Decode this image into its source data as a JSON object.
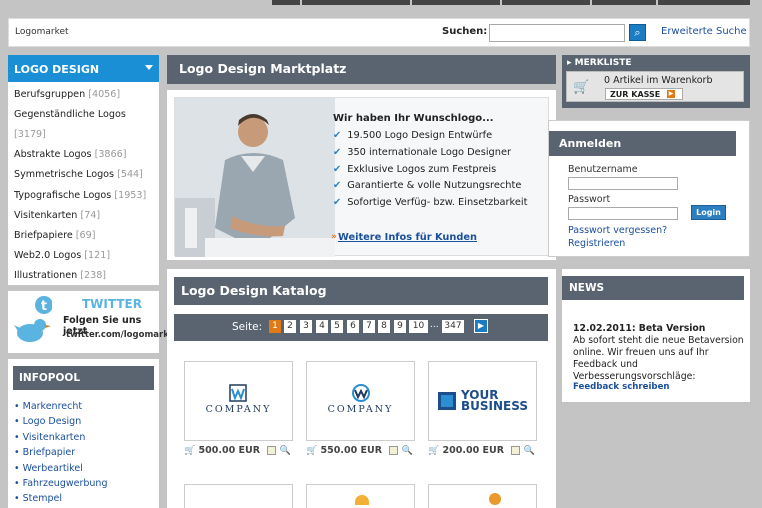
{
  "header": {
    "breadcrumb": "Logomarket",
    "search_label": "Suchen:",
    "search_placeholder": "",
    "advanced_search": "Erweiterte Suche"
  },
  "categories": {
    "title": "LOGO DESIGN",
    "items": [
      {
        "label": "Berufsgruppen",
        "count": "[4056]"
      },
      {
        "label": "Gegenständliche Logos",
        "count": "[3179]"
      },
      {
        "label": "Abstrakte Logos",
        "count": "[3866]"
      },
      {
        "label": "Symmetrische Logos",
        "count": "[544]"
      },
      {
        "label": "Typografische Logos",
        "count": "[1953]"
      },
      {
        "label": "Visitenkarten",
        "count": "[74]"
      },
      {
        "label": "Briefpapiere",
        "count": "[69]"
      },
      {
        "label": "Web2.0 Logos",
        "count": "[121]"
      },
      {
        "label": "Illustrationen",
        "count": "[238]"
      }
    ]
  },
  "twitter": {
    "title": "TWITTER",
    "follow": "Folgen Sie uns jetzt",
    "url": "twitter.com/logomarket"
  },
  "infopool": {
    "title": "INFOPOOL",
    "items": [
      "Markenrecht",
      "Logo Design",
      "Visitenkarten",
      "Briefpapier",
      "Werbeartikel",
      "Fahrzeugwerbung",
      "Stempel"
    ]
  },
  "main": {
    "title": "Logo Design Marktplatz"
  },
  "merkliste": {
    "title": "MERKLISTE",
    "count_text": "0 Artikel im Warenkorb",
    "checkout": "ZUR KASSE"
  },
  "hero": {
    "title": "Wir haben Ihr Wunschlogo...",
    "bullets": [
      "19.500 Logo Design Entwürfe",
      "350 internationale Logo Designer",
      "Exklusive Logos zum Festpreis",
      "Garantierte & volle Nutzungsrechte",
      "Sofortige Verfüg- bzw. Einsetzbarkeit"
    ],
    "more_link": "Weitere Infos für Kunden"
  },
  "login": {
    "title": "Anmelden",
    "username_label": "Benutzername",
    "password_label": "Passwort",
    "button": "Login",
    "forgot": "Passwort vergessen?",
    "register": "Registrieren"
  },
  "katalog": {
    "title": "Logo Design Katalog",
    "page_label": "Seite:",
    "pages": [
      "1",
      "2",
      "3",
      "4",
      "5",
      "6",
      "7",
      "8",
      "9",
      "10"
    ],
    "ellipsis": "...",
    "last_page": "347",
    "products": [
      {
        "price": "500.00 EUR",
        "logo_text": "COMPANY"
      },
      {
        "price": "550.00 EUR",
        "logo_text": "COMPANY"
      },
      {
        "price": "200.00 EUR",
        "logo_text": "YOUR BUSINESS"
      }
    ]
  },
  "news": {
    "title": "NEWS",
    "headline": "12.02.2011: Beta Version",
    "body": "Ab sofort steht die neue Betaversion online. Wir freuen uns auf Ihr Feedback und Verbesserungsvorschläge:",
    "link": "Feedback schreiben"
  },
  "colors": {
    "accent_blue": "#1a8fd6",
    "panel_gray": "#5a6470",
    "orange": "#e07a16"
  }
}
